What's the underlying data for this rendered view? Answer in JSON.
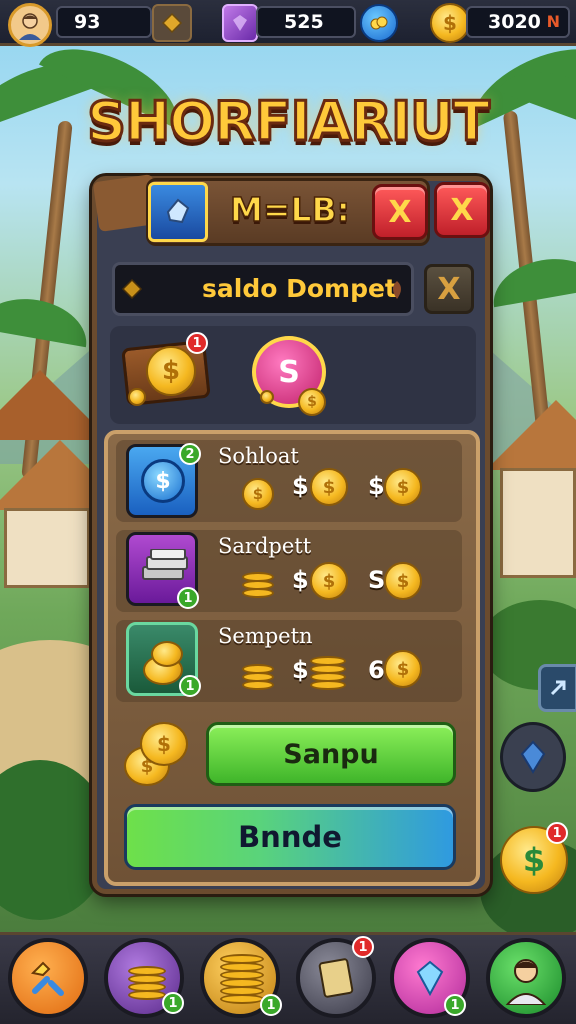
{
  "hud": {
    "avatar_icon": "player-avatar",
    "level_value": "93",
    "gem_value": "525",
    "coin_value": "3020",
    "close_label": "N"
  },
  "title": "SHORFIARIUT",
  "panel": {
    "header_label": "M=LB:",
    "close_a_label": "X",
    "close_b_label": "X",
    "saldo_label": "saldo Dompet",
    "saldo_close_label": "X",
    "wallet_badge": "1",
    "coin_icon_label": "S"
  },
  "shop": {
    "items": [
      {
        "label": "Sohloat",
        "badge": "2",
        "price_symbol_a": "$",
        "price_symbol_b": "$"
      },
      {
        "label": "Sardpett",
        "badge": "1",
        "price_symbol_a": "$",
        "price_symbol_b": "S"
      },
      {
        "label": "Sempetn",
        "badge": "1",
        "price_symbol_a": "$",
        "price_symbol_b": "6"
      }
    ],
    "green_button_label": "Sanpu",
    "blue_button_label": "Bnnde"
  },
  "side": {
    "coin_badge": "1"
  },
  "nav": {
    "items": [
      {
        "icon": "puzzle-icon"
      },
      {
        "icon": "coins-icon",
        "badge": "1"
      },
      {
        "icon": "coin-stack-icon",
        "badge": "1"
      },
      {
        "icon": "card-icon",
        "badge": "1"
      },
      {
        "icon": "gem-icon",
        "badge": "1"
      },
      {
        "icon": "profile-icon"
      }
    ]
  },
  "colors": {
    "accent_gold": "#ffc93a",
    "button_green": "#3fb52a",
    "button_blue": "#2f9ae0",
    "danger_red": "#c0202a"
  }
}
